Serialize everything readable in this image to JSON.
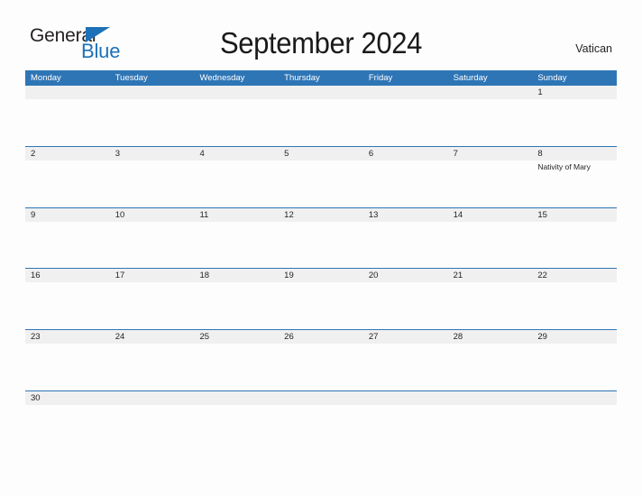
{
  "brand": {
    "word_one": "General",
    "word_two": "Blue",
    "triangle_icon": "triangle-icon",
    "accent_color": "#1d71b8",
    "text_color": "#231f20"
  },
  "header": {
    "title": "September 2024",
    "month": "September",
    "year": "2024",
    "locale": "Vatican"
  },
  "theme": {
    "header_blue": "#2e75b6",
    "row_separator": "#2e75b6",
    "date_band_gray": "#f0f0f0",
    "page_background": "#fdfdfd",
    "text": "#231f20"
  },
  "calendar": {
    "first_day_of_week": "Monday",
    "weekdays": [
      "Monday",
      "Tuesday",
      "Wednesday",
      "Thursday",
      "Friday",
      "Saturday",
      "Sunday"
    ],
    "weeks": [
      {
        "days": [
          {
            "date": "",
            "event": ""
          },
          {
            "date": "",
            "event": ""
          },
          {
            "date": "",
            "event": ""
          },
          {
            "date": "",
            "event": ""
          },
          {
            "date": "",
            "event": ""
          },
          {
            "date": "",
            "event": ""
          },
          {
            "date": "1",
            "event": ""
          }
        ]
      },
      {
        "days": [
          {
            "date": "2",
            "event": ""
          },
          {
            "date": "3",
            "event": ""
          },
          {
            "date": "4",
            "event": ""
          },
          {
            "date": "5",
            "event": ""
          },
          {
            "date": "6",
            "event": ""
          },
          {
            "date": "7",
            "event": ""
          },
          {
            "date": "8",
            "event": "Nativity of Mary"
          }
        ]
      },
      {
        "days": [
          {
            "date": "9",
            "event": ""
          },
          {
            "date": "10",
            "event": ""
          },
          {
            "date": "11",
            "event": ""
          },
          {
            "date": "12",
            "event": ""
          },
          {
            "date": "13",
            "event": ""
          },
          {
            "date": "14",
            "event": ""
          },
          {
            "date": "15",
            "event": ""
          }
        ]
      },
      {
        "days": [
          {
            "date": "16",
            "event": ""
          },
          {
            "date": "17",
            "event": ""
          },
          {
            "date": "18",
            "event": ""
          },
          {
            "date": "19",
            "event": ""
          },
          {
            "date": "20",
            "event": ""
          },
          {
            "date": "21",
            "event": ""
          },
          {
            "date": "22",
            "event": ""
          }
        ]
      },
      {
        "days": [
          {
            "date": "23",
            "event": ""
          },
          {
            "date": "24",
            "event": ""
          },
          {
            "date": "25",
            "event": ""
          },
          {
            "date": "26",
            "event": ""
          },
          {
            "date": "27",
            "event": ""
          },
          {
            "date": "28",
            "event": ""
          },
          {
            "date": "29",
            "event": ""
          }
        ]
      },
      {
        "days": [
          {
            "date": "30",
            "event": ""
          },
          {
            "date": "",
            "event": ""
          },
          {
            "date": "",
            "event": ""
          },
          {
            "date": "",
            "event": ""
          },
          {
            "date": "",
            "event": ""
          },
          {
            "date": "",
            "event": ""
          },
          {
            "date": "",
            "event": ""
          }
        ]
      }
    ]
  }
}
